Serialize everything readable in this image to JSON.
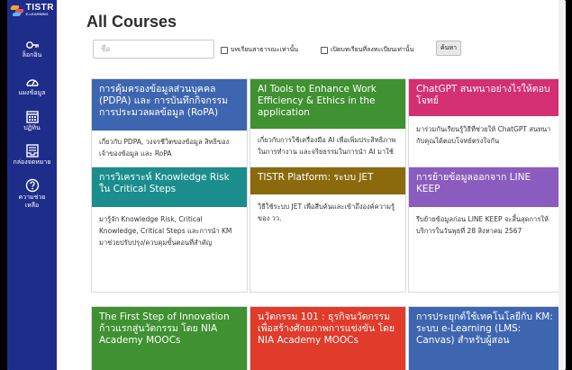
{
  "sidebar": {
    "logo": {
      "text": "TISTR",
      "subtext": "E-LEARNING"
    },
    "items": [
      {
        "label": "ล็อกอิน",
        "icon": "login-icon"
      },
      {
        "label": "แผงข้อมูล",
        "icon": "dashboard-icon"
      },
      {
        "label": "ปฏิทิน",
        "icon": "calendar-icon"
      },
      {
        "label": "กล่องจดหมาย",
        "icon": "inbox-icon"
      },
      {
        "label": "ความช่วย",
        "label2": "เหลือ",
        "icon": "help-icon"
      }
    ],
    "color": "#1f2d8a"
  },
  "main": {
    "title": "All Courses",
    "search": {
      "placeholder": "ชื่อ",
      "value": ""
    },
    "filters": [
      {
        "label": "บทเรียนสาธารณะเท่านั้น",
        "checked": false
      },
      {
        "label": "เปิดบทเรียนที่ลงทะเบียนเท่านั้น",
        "checked": false
      }
    ],
    "search_button": "ค้นหา"
  },
  "courses": [
    {
      "title": "การคุ้มครองข้อมูลส่วนบุคคล (PDPA) และ การบันทึกกิจกรรม การประมวลผลข้อมูล (RoPA)",
      "desc": "เกี่ยวกับ PDPA, วงจรชีวิตของข้อมูล สิทธิของเจ้าของข้อมูล และ RoPA",
      "color": "#3e66b0"
    },
    {
      "title": "AI Tools to Enhance Work Efficiency & Ethics in the application",
      "desc": "เกี่ยวกับการใช้เครื่องมือ AI เพื่อเพิ่มประสิทธิภาพในการทำงาน และจริยธรรมในการนำ AI มาใช้",
      "color": "#3f9131"
    },
    {
      "title": "ChatGPT สนทนาอย่างไรให้ตอบโจทย์",
      "desc": "มาร่วมกันเรียนรู้วิธีที่ช่วยให้ ChatGPT สนทนากับคุณได้ตอบโจทย์ตรงใจกัน",
      "color": "#d42f72"
    },
    {
      "title": "การวิเคราะห์ Knowledge Risk ใน Critical Steps",
      "desc": "มารู้จัก Knowledge Risk, Critical Knowledge, Critical Steps และการนำ KM มาช่วยปรับปรุง/ควบคุมขั้นตอนที่สำคัญ",
      "color": "#1b8d8d"
    },
    {
      "title": "TISTR Platform: ระบบ JET",
      "desc": "วิธีใช้ระบบ JET เพื่อสืบค้นและเข้าถึงองค์ความรู้ของ วว.",
      "color": "#8a6a0c"
    },
    {
      "title": "การย้ายข้อมูลออกจาก LINE KEEP",
      "desc": "รีบย้ายข้อมูลก่อน LINE KEEP จะสิ้นสุดการให้บริการในวันพุธที่ 28 สิงหาคม 2567",
      "color": "#8b5cbf"
    },
    {
      "title": "The First Step of Innovation ก้าวแรกสู่นวัตกรรม โดย NIA Academy MOOCs",
      "desc": "",
      "color": "#3f9131"
    },
    {
      "title": "นวัตกรรม 101 : ธุรกิจนวัตกรรมเพื่อสร้างศักยภาพการแข่งขัน โดย NIA Academy MOOCs",
      "desc": "",
      "color": "#e03b2b"
    },
    {
      "title": "การประยุกต์ใช้เทคโนโลยีกับ KM: ระบบ e-Learning (LMS: Canvas) สำหรับผู้สอน",
      "desc": "",
      "color": "#3e66b0"
    }
  ]
}
